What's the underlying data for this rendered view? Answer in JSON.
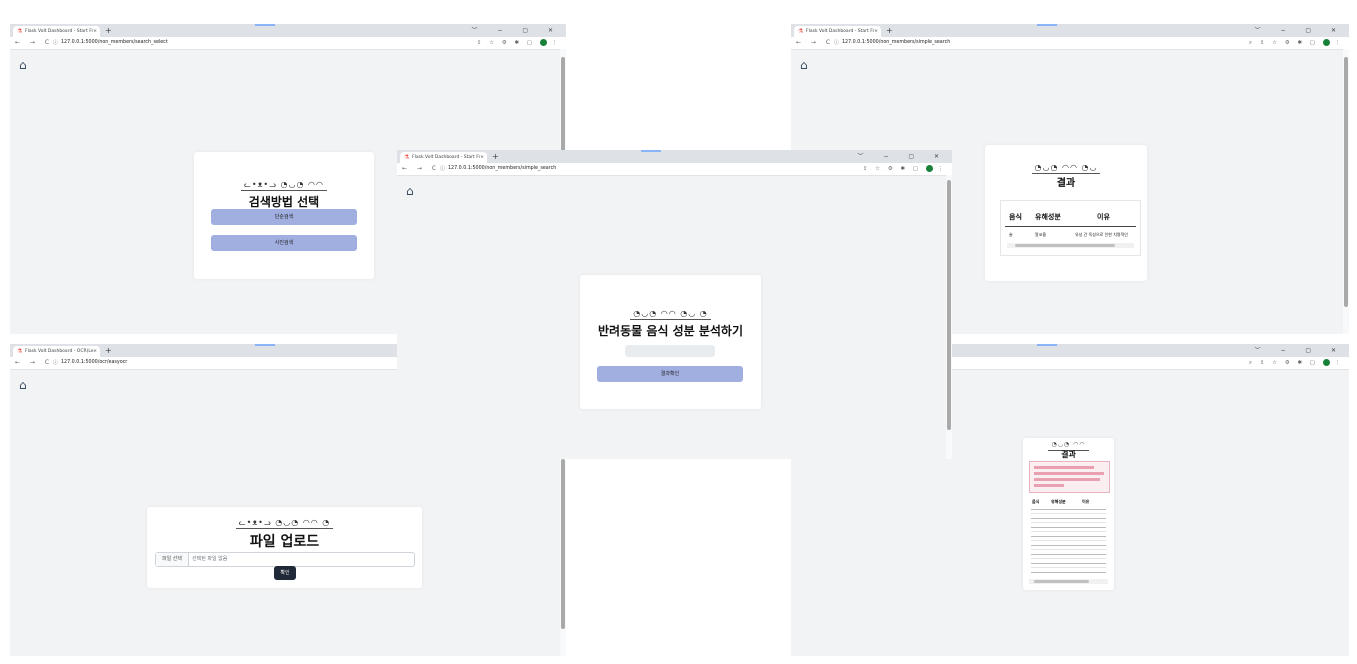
{
  "browser": {
    "tab_title": "Flask Volt Dashboard - Start Fr",
    "tab_title_ocr": "Flask Volt Dashboard - OCR(Le",
    "tab_favicon": "flask-icon",
    "tab_close": "×",
    "new_tab": "+",
    "window_controls": "﹀ − ▢ ✕",
    "nav_buttons": "← → C",
    "info_icon": "ⓘ",
    "avatar_color": "#188038"
  },
  "windows": {
    "search_select": {
      "url": "127.0.0.1:5000/non_members/search_select",
      "heading": "검색방법 선택",
      "simple_button": "단순검색",
      "photo_button": "사진검색"
    },
    "simple_search_result": {
      "url": "127.0.0.1:5000/non_members/simple_search",
      "heading": "결과",
      "columns": [
        "음식",
        "유해성분",
        "이유"
      ],
      "row": [
        "술",
        "알코올",
        "유성 간 독성으로 인한 치명적인"
      ]
    },
    "simple_search": {
      "url": "127.0.0.1:5000/non_members/simple_search",
      "heading": "반려동물 음식 성분 분석하기",
      "input_value": "",
      "submit_button": "결과확인"
    },
    "ocr_upload": {
      "url": "127.0.0.1:5000/ocr/easyocr",
      "heading": "파일 업로드",
      "file_button": "파일 선택",
      "file_placeholder": "선택된 파일 없음",
      "confirm_button": "확인"
    },
    "ocr_result": {
      "heading": "결과",
      "columns": [
        "음식",
        "유해성분",
        "이유"
      ]
    }
  },
  "colors": {
    "page_bg": "#f2f3f5",
    "button": "#a0aee0",
    "dark_button": "#1f2937",
    "tabstrip": "#dee1e6"
  }
}
